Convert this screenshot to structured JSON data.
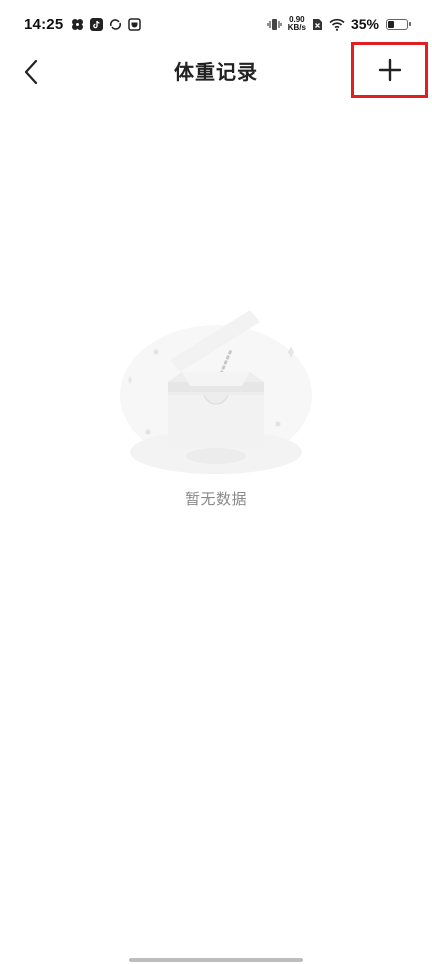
{
  "status_bar": {
    "time": "14:25",
    "net_speed_value": "0.90",
    "net_speed_unit": "KB/s",
    "battery_percent": "35%",
    "battery_level": 0.35,
    "notification_icons": [
      "pinwheel-icon",
      "tiktok-icon",
      "sync-icon",
      "shop-icon"
    ],
    "system_icons": [
      "vibrate-icon",
      "no-sim-icon",
      "wifi-icon",
      "battery-icon"
    ]
  },
  "nav": {
    "title": "体重记录",
    "back_icon": "chevron-left-icon",
    "add_icon": "plus-icon"
  },
  "empty_state": {
    "text": "暂无数据",
    "illustration": "empty-inbox-illustration"
  }
}
